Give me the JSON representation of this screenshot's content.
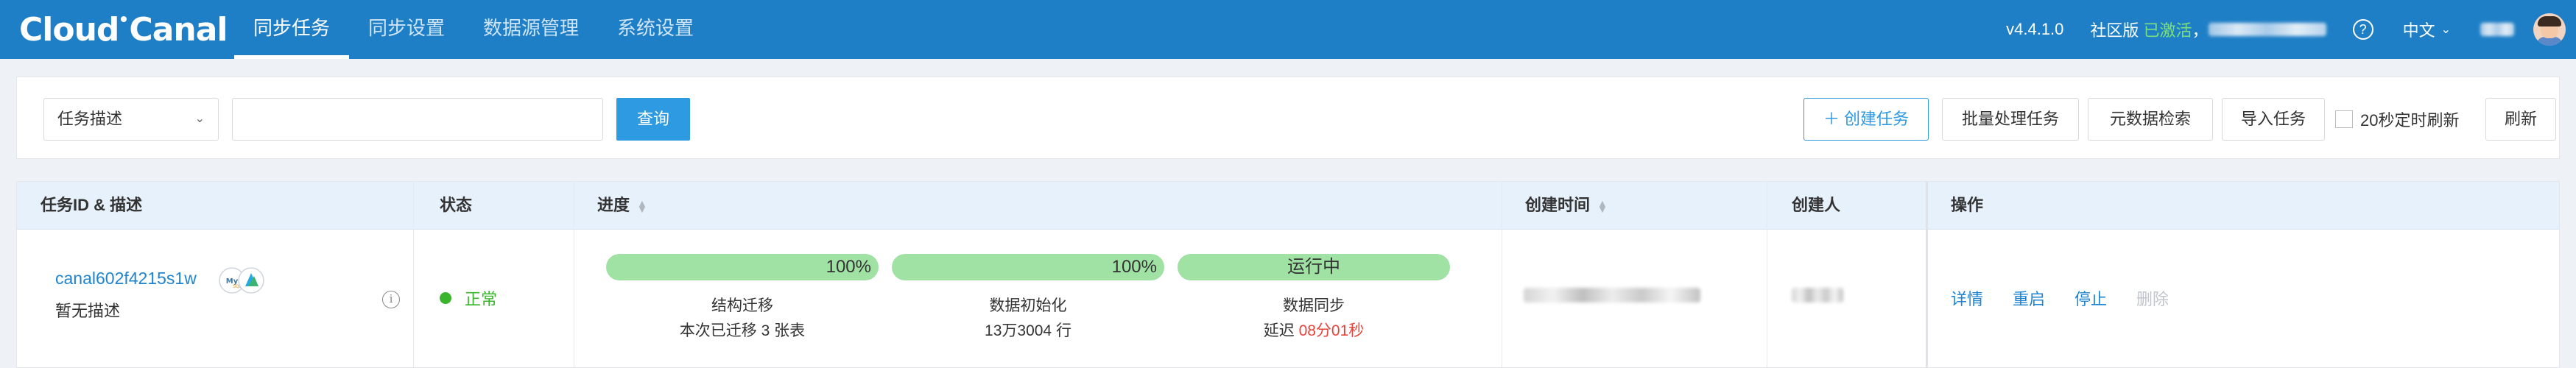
{
  "brand": {
    "logo_left": "Cloud",
    "logo_right": "Canal"
  },
  "nav": {
    "items": [
      {
        "label": "同步任务",
        "active": true
      },
      {
        "label": "同步设置",
        "active": false
      },
      {
        "label": "数据源管理",
        "active": false
      },
      {
        "label": "系统设置",
        "active": false
      }
    ]
  },
  "header": {
    "version": "v4.4.1.0",
    "edition": "社区版",
    "activation": "已激活",
    "separator": "，",
    "language": "中文"
  },
  "filter": {
    "select_value": "任务描述",
    "search_value": "",
    "query_label": "查询",
    "create_label": "＋ 创建任务",
    "batch_label": "批量处理任务",
    "meta_label": "元数据检索",
    "import_label": "导入任务",
    "autorefresh_label": "20秒定时刷新",
    "autorefresh_checked": false,
    "refresh_label": "刷新"
  },
  "table": {
    "columns": {
      "id": "任务ID & 描述",
      "status": "状态",
      "progress": "进度",
      "created_time": "创建时间",
      "creator": "创建人",
      "actions": "操作"
    },
    "rows": [
      {
        "task_id": "canal602f4215s1w",
        "description": "暂无描述",
        "source_db_icon": "mysql-icon",
        "target_db_icon": "target-db-icon",
        "status": "正常",
        "status_color": "#38b52d",
        "stages": [
          {
            "progress_text": "100%",
            "progress": 1.0,
            "label": "结构迁移",
            "detail": "本次已迁移 3 张表"
          },
          {
            "progress_text": "100%",
            "progress": 1.0,
            "label": "数据初始化",
            "detail": "13万3004 行"
          },
          {
            "progress_text": "运行中",
            "progress": 1.0,
            "label": "数据同步",
            "detail_prefix": "延迟 ",
            "detail_delay": "08分01秒"
          }
        ],
        "actions": [
          {
            "label": "详情",
            "enabled": true
          },
          {
            "label": "重启",
            "enabled": true
          },
          {
            "label": "停止",
            "enabled": true
          },
          {
            "label": "删除",
            "enabled": false
          }
        ]
      }
    ]
  },
  "colors": {
    "topbar": "#1f7fc6",
    "primary": "#2d9ae2",
    "progress_fill": "#a0e1a4",
    "delay_red": "#e8433a",
    "header_bg": "#e7f1fb"
  }
}
